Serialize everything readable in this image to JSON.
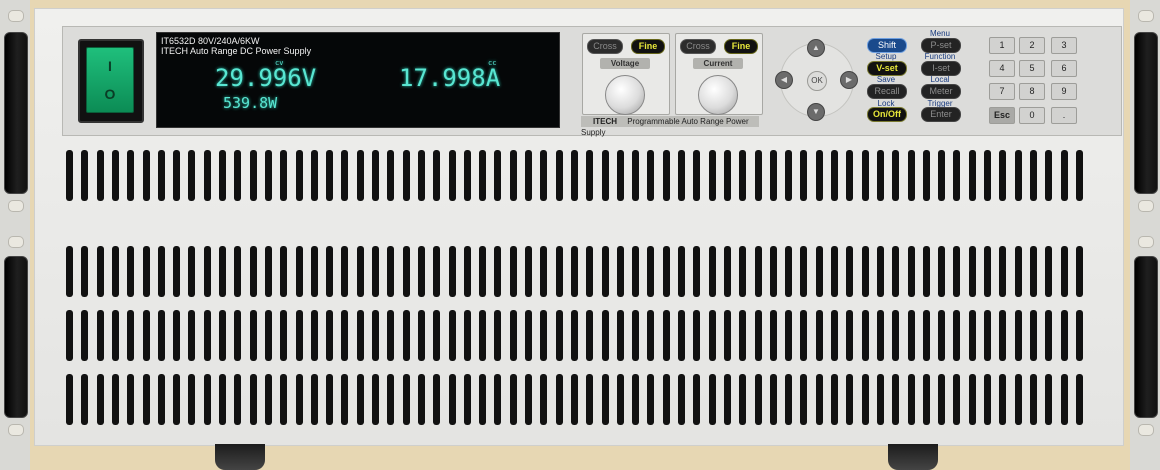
{
  "display": {
    "model_line": "IT6532D  80V/240A/6KW",
    "description_line": "ITECH Auto Range DC Power Supply",
    "voltage_reading": "29.996V",
    "current_reading": "17.998A",
    "power_reading": "539.8W",
    "cc_indicator": "cc",
    "cv_indicator": "cv"
  },
  "voltage_knob_panel": {
    "cross_label": "Cross",
    "fine_label": "Fine",
    "title": "Voltage"
  },
  "current_knob_panel": {
    "cross_label": "Cross",
    "fine_label": "Fine",
    "title": "Current"
  },
  "brand_strip": {
    "brand": "ITECH",
    "tagline": "Programmable Auto Range Power Supply"
  },
  "navigation": {
    "ok_label": "OK"
  },
  "function_keys": {
    "shift": "Shift",
    "vset": "V-set",
    "recall": "Recall",
    "onoff": "On/Off",
    "pset": "P-set",
    "iset": "I-set",
    "meter": "Meter",
    "enter": "Enter",
    "setup": "Setup",
    "save": "Save",
    "lock": "Lock",
    "menu": "Menu",
    "function": "Function",
    "local": "Local",
    "trigger": "Trigger"
  },
  "numeric_keys": [
    "1",
    "2",
    "3",
    "4",
    "5",
    "6",
    "7",
    "8",
    "9",
    "Esc",
    "0",
    "."
  ],
  "power_switch": {
    "on_symbol": "I",
    "off_symbol": "O"
  },
  "colors": {
    "vfd_text": "#59e6d2",
    "fine_key": "#e6e63a",
    "shift_key": "#1a4a8c",
    "power_rocker": "#1fbf7c"
  }
}
